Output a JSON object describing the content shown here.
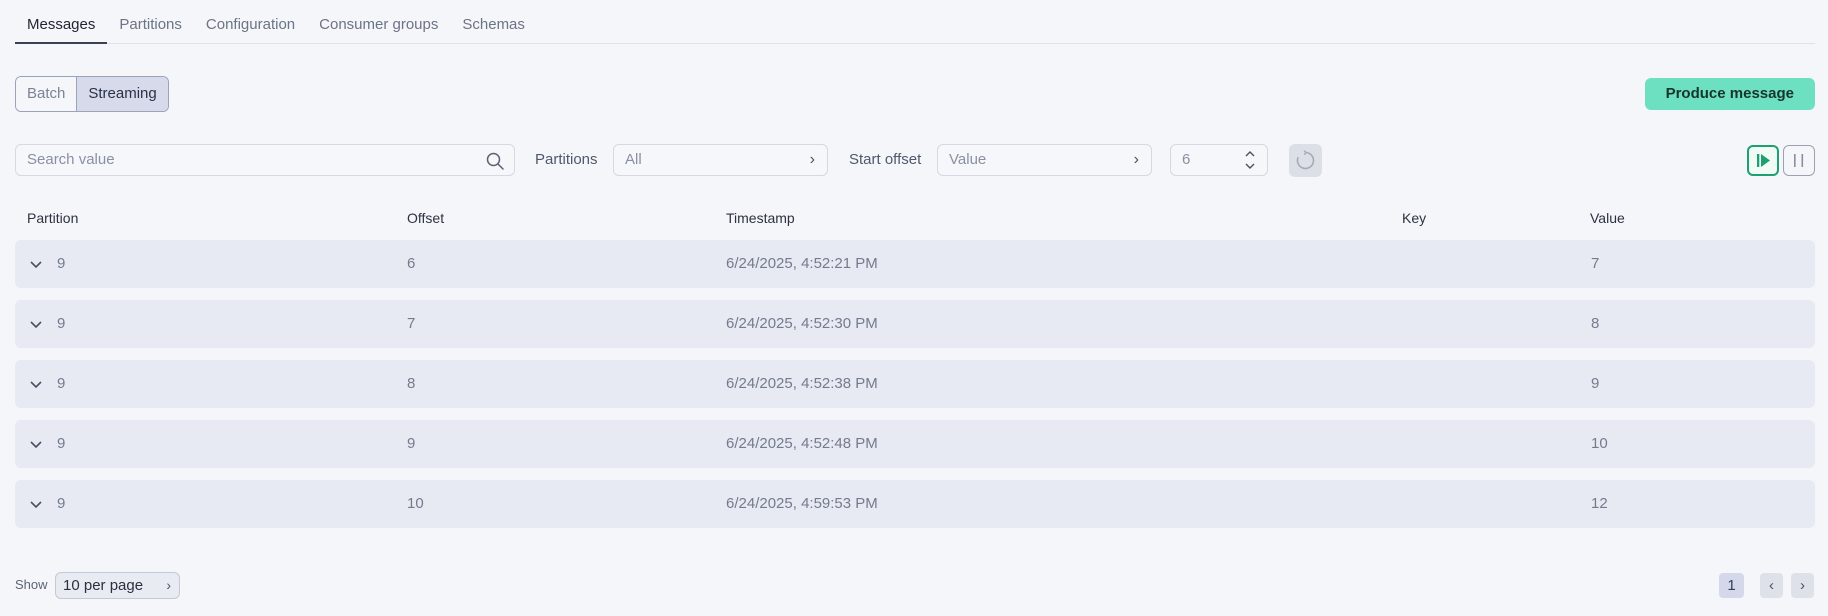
{
  "tabs": [
    {
      "label": "Messages",
      "active": true
    },
    {
      "label": "Partitions"
    },
    {
      "label": "Configuration"
    },
    {
      "label": "Consumer groups"
    },
    {
      "label": "Schemas"
    }
  ],
  "mode": {
    "batch": "Batch",
    "streaming": "Streaming",
    "selected": "Streaming"
  },
  "produce_button": "Produce message",
  "filters": {
    "search_placeholder": "Search value",
    "partitions_label": "Partitions",
    "partitions_value": "All",
    "start_offset_label": "Start offset",
    "start_offset_value": "Value",
    "offset_number": "6"
  },
  "table": {
    "headers": [
      "Partition",
      "Offset",
      "Timestamp",
      "Key",
      "Value"
    ],
    "rows": [
      {
        "partition": "9",
        "offset": "6",
        "timestamp": "6/24/2025, 4:52:21 PM",
        "key": "",
        "value": "7"
      },
      {
        "partition": "9",
        "offset": "7",
        "timestamp": "6/24/2025, 4:52:30 PM",
        "key": "",
        "value": "8"
      },
      {
        "partition": "9",
        "offset": "8",
        "timestamp": "6/24/2025, 4:52:38 PM",
        "key": "",
        "value": "9"
      },
      {
        "partition": "9",
        "offset": "9",
        "timestamp": "6/24/2025, 4:52:48 PM",
        "key": "",
        "value": "10"
      },
      {
        "partition": "9",
        "offset": "10",
        "timestamp": "6/24/2025, 4:59:53 PM",
        "key": "",
        "value": "12"
      }
    ]
  },
  "footer": {
    "show_label": "Show",
    "per_page": "10 per page",
    "current_page": "1"
  },
  "colors": {
    "accent": "#6ee0c2",
    "play_border": "#1e9f73",
    "row_bg": "#e8eaf3"
  }
}
